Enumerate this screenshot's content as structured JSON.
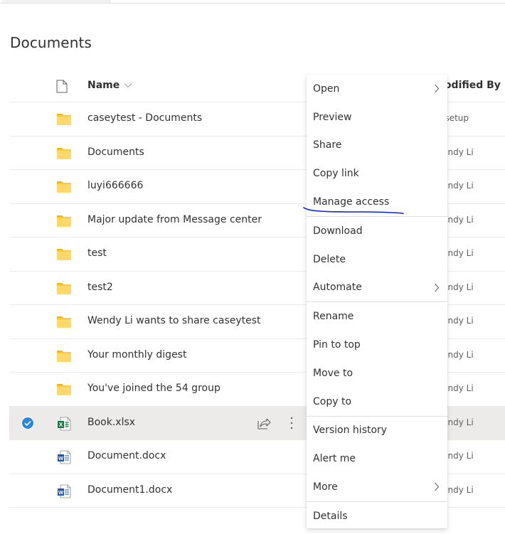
{
  "page": {
    "title": "Documents"
  },
  "list": {
    "columns": {
      "name": "Name",
      "modified_by": "Modified By"
    },
    "rows": [
      {
        "name": "caseytest - Documents",
        "type": "folder",
        "modified_by": "Assetup",
        "selected": false
      },
      {
        "name": "Documents",
        "type": "folder",
        "modified_by": "Wendy Li",
        "selected": false
      },
      {
        "name": "luyi666666",
        "type": "folder",
        "modified_by": "Wendy Li",
        "selected": false
      },
      {
        "name": "Major update from Message center",
        "type": "folder",
        "modified_by": "Wendy Li",
        "selected": false
      },
      {
        "name": "test",
        "type": "folder",
        "modified_by": "Wendy Li",
        "selected": false
      },
      {
        "name": "test2",
        "type": "folder",
        "modified_by": "Wendy Li",
        "selected": false
      },
      {
        "name": "Wendy Li wants to share caseytest",
        "type": "folder",
        "modified_by": "Wendy Li",
        "selected": false
      },
      {
        "name": "Your monthly digest",
        "type": "folder",
        "modified_by": "Wendy Li",
        "selected": false
      },
      {
        "name": "You've joined the 54 group",
        "type": "folder",
        "modified_by": "Wendy Li",
        "selected": false
      },
      {
        "name": "Book.xlsx",
        "type": "excel",
        "modified_by": "Wendy Li",
        "selected": true
      },
      {
        "name": "Document.docx",
        "type": "word",
        "modified_by": "Wendy Li",
        "selected": false
      },
      {
        "name": "Document1.docx",
        "type": "word",
        "modified_by": "Wendy Li",
        "selected": false
      }
    ]
  },
  "context_menu": {
    "groups": [
      [
        {
          "label": "Open",
          "submenu": true
        },
        {
          "label": "Preview",
          "submenu": false
        },
        {
          "label": "Share",
          "submenu": false
        },
        {
          "label": "Copy link",
          "submenu": false
        },
        {
          "label": "Manage access",
          "submenu": false,
          "annotated": true
        }
      ],
      [
        {
          "label": "Download",
          "submenu": false
        },
        {
          "label": "Delete",
          "submenu": false
        },
        {
          "label": "Automate",
          "submenu": true
        }
      ],
      [
        {
          "label": "Rename",
          "submenu": false
        },
        {
          "label": "Pin to top",
          "submenu": false
        },
        {
          "label": "Move to",
          "submenu": false
        },
        {
          "label": "Copy to",
          "submenu": false
        }
      ],
      [
        {
          "label": "Version history",
          "submenu": false
        },
        {
          "label": "Alert me",
          "submenu": false
        },
        {
          "label": "More",
          "submenu": true
        }
      ],
      [
        {
          "label": "Details",
          "submenu": false
        }
      ]
    ]
  },
  "colors": {
    "selected_row_bg": "#edebe9",
    "check_blue": "#2b88d8",
    "folder_yellow": "#ffd86b",
    "excel_green": "#107c41",
    "word_blue": "#185abd",
    "annotation_ink": "#0a1ed8"
  }
}
